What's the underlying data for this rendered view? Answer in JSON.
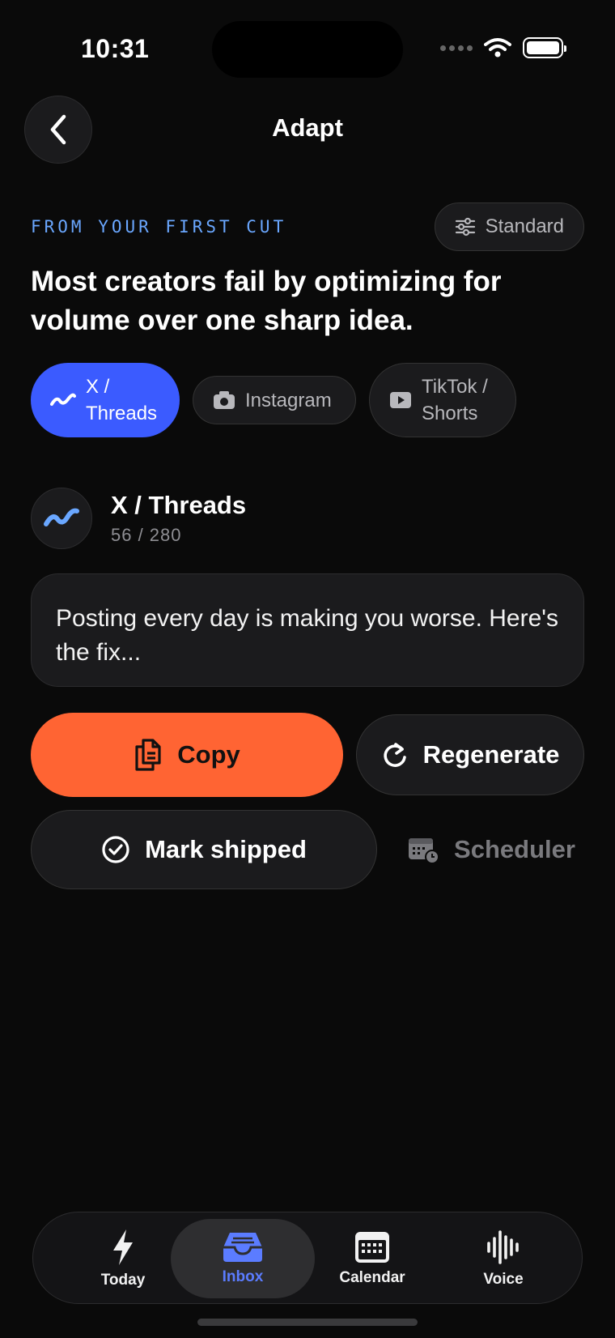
{
  "status": {
    "time": "10:31"
  },
  "header": {
    "title": "Adapt"
  },
  "source": {
    "eyebrow": "FROM YOUR FIRST CUT",
    "mode_label": "Standard"
  },
  "headline": "Most creators fail by optimizing for volume over one sharp idea.",
  "platform_chips": [
    {
      "label": "X / Threads",
      "icon": "waveform-icon",
      "selected": true
    },
    {
      "label": "Instagram",
      "icon": "camera-icon",
      "selected": false
    },
    {
      "label": "TikTok / Shorts",
      "icon": "play-icon",
      "selected": false
    }
  ],
  "platform": {
    "name": "X / Threads",
    "char_count": "56 / 280"
  },
  "draft": {
    "text": "Posting every day is making you worse. Here's the fix..."
  },
  "actions": {
    "copy": "Copy",
    "regenerate": "Regenerate",
    "mark_shipped": "Mark shipped",
    "scheduler": "Scheduler"
  },
  "tabs": [
    {
      "label": "Today",
      "icon": "bolt-icon",
      "active": false
    },
    {
      "label": "Inbox",
      "icon": "inbox-tray-icon",
      "active": true
    },
    {
      "label": "Calendar",
      "icon": "calendar-icon",
      "active": false
    },
    {
      "label": "Voice",
      "icon": "voice-wave-icon",
      "active": false
    }
  ],
  "colors": {
    "accent_blue": "#3b5bff",
    "eyebrow_blue": "#6aa7ff",
    "copy_orange": "#ff6433",
    "inbox_active": "#5b7cff"
  }
}
